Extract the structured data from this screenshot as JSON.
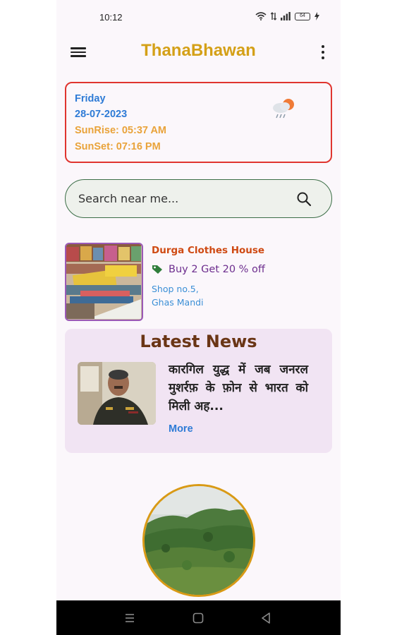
{
  "status_bar": {
    "time": "10:12",
    "battery": "64"
  },
  "app_bar": {
    "title": "ThanaBhawan"
  },
  "date_card": {
    "day": "Friday",
    "date": "28-07-2023",
    "sunrise": "SunRise: 05:37 AM",
    "sunset": "SunSet: 07:16 PM",
    "weather_icon": "cloud-rain-sun-icon"
  },
  "search": {
    "placeholder": "Search near me..."
  },
  "shop": {
    "name": "Durga Clothes House",
    "offer": "Buy 2 Get 20 % off",
    "address_line1": "Shop no.5,",
    "address_line2": "Ghas Mandi"
  },
  "news": {
    "heading": "Latest News",
    "headline": "कारगिल युद्ध में जब जनरल मुशर्रफ़ के फ़ोन से भारत को मिली अह...",
    "more_label": "More"
  },
  "colors": {
    "brand": "#d4a017",
    "date_border": "#e0352f",
    "date_text": "#2e7bd6",
    "sun_text": "#e9a33a",
    "shop_name": "#cf4a13",
    "offer_text": "#6d2e8e",
    "news_bg": "#f1e4f3",
    "news_heading": "#6a3515"
  }
}
